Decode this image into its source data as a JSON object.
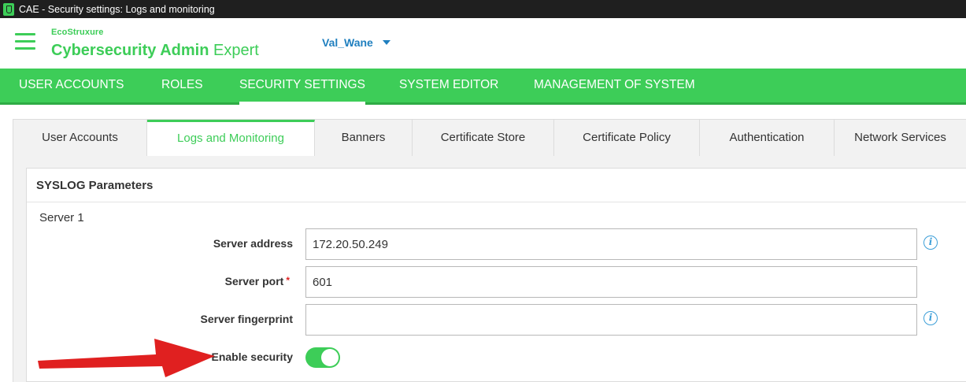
{
  "window": {
    "title": "CAE - Security settings: Logs and monitoring"
  },
  "brand": {
    "logo_text": "EcoStruxure",
    "product_bold": "Cybersecurity Admin",
    "product_light": " Expert"
  },
  "user": {
    "name": "Val_Wane"
  },
  "mainnav": {
    "items": [
      "USER ACCOUNTS",
      "ROLES",
      "SECURITY SETTINGS",
      "SYSTEM EDITOR",
      "MANAGEMENT OF SYSTEM"
    ],
    "active": "SECURITY SETTINGS"
  },
  "subtabs": {
    "items": [
      "User Accounts",
      "Logs and Monitoring",
      "Banners",
      "Certificate Store",
      "Certificate Policy",
      "Authentication",
      "Network Services"
    ],
    "active": "Logs and Monitoring"
  },
  "panel": {
    "title": "SYSLOG Parameters",
    "group": "Server 1",
    "fields": {
      "server_address": {
        "label": "Server address",
        "value": "172.20.50.249"
      },
      "server_port": {
        "label": "Server port",
        "required_mark": "*",
        "value": "601"
      },
      "server_fingerprint": {
        "label": "Server fingerprint",
        "value": ""
      },
      "enable_security": {
        "label": "Enable security",
        "state": "on"
      }
    }
  },
  "colors": {
    "brand_green": "#3dcd58",
    "link_blue": "#1f7fbf",
    "info_blue": "#3d9fd8",
    "annotation_red": "#e02020"
  },
  "icons": {
    "menu": "hamburger-icon",
    "info": "info-icon",
    "annotation": "red-arrow"
  }
}
